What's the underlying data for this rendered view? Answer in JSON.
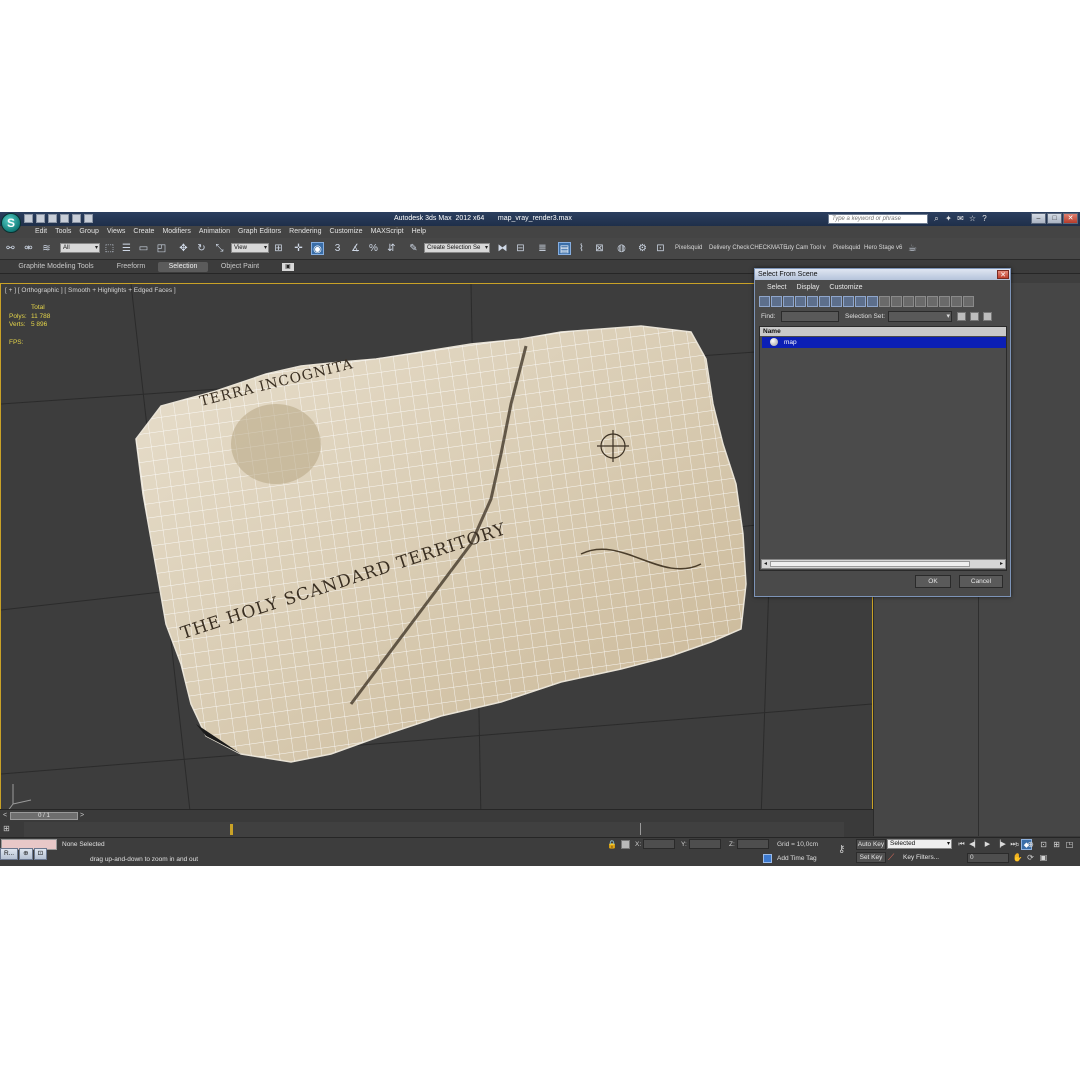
{
  "app": {
    "title": "Autodesk 3ds Max  2012 x64       map_vray_render3.max",
    "search_placeholder": "Type a keyword or phrase",
    "logo_icon": "3ds-max-logo-icon"
  },
  "menu": [
    "Edit",
    "Tools",
    "Group",
    "Views",
    "Create",
    "Modifiers",
    "Animation",
    "Graph Editors",
    "Rendering",
    "Customize",
    "MAXScript",
    "Help"
  ],
  "toolbar": {
    "filter_value": "All",
    "refcoord_value": "View",
    "named_selection_value": "Create Selection Se",
    "plugin_labels": [
      "Pixelsquid",
      "Delivery Check",
      "CHECKMATE",
      "uty Cam Tool v",
      "Pixelsquid",
      "Hero Stage v6"
    ]
  },
  "ribbon": {
    "tabs": [
      "Graphite Modeling Tools",
      "Freeform",
      "Selection",
      "Object Paint"
    ],
    "active_tab": "Selection"
  },
  "viewport": {
    "label": "[ + ] [ Orthographic ] [ Smooth + Highlights + Edged Faces ]",
    "stats": {
      "total_label": "Total",
      "polys_label": "Polys:",
      "polys_value": "11 788",
      "verts_label": "Verts:",
      "verts_value": "5 896",
      "fps_label": "FPS:"
    },
    "map_texts": [
      "TERRA INCOGNITA",
      "THE HOLY SCANDARD TERRITORY"
    ]
  },
  "dialog": {
    "title": "Select From Scene",
    "close_label": "✕",
    "menus": [
      "Select",
      "Display",
      "Customize"
    ],
    "find_label": "Find:",
    "selection_set_label": "Selection Set:",
    "column_header": "Name",
    "rows": [
      "map"
    ],
    "ok_label": "OK",
    "cancel_label": "Cancel"
  },
  "timeline": {
    "frame_label": "0 / 1",
    "prev_label": "<",
    "next_label": ">"
  },
  "status": {
    "selection": "None Selected",
    "prompt": "drag up-and-down to zoom in and out",
    "x_label": "X:",
    "y_label": "Y:",
    "z_label": "Z:",
    "grid": "Grid = 10,0cm",
    "add_time_tag": "Add Time Tag",
    "auto_key": "Auto Key",
    "set_key": "Set Key",
    "key_mode": "Selected",
    "key_filters": "Key Filters...",
    "current_frame": "0"
  },
  "taskbar": {
    "buttons": [
      "R...",
      "⊕",
      "⊡"
    ]
  },
  "colors": {
    "stats_text": "#e5d54a",
    "viewport_border": "#c9a227",
    "selection_row": "#0b1fb5",
    "title_bar": "#223454"
  }
}
